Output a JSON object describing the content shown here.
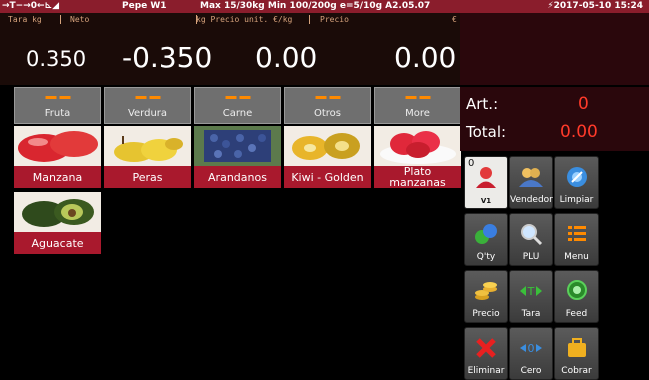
{
  "status": {
    "icons_text": "→T−→0←⊾◢",
    "user": "Pepe  W1",
    "limits": "Max 15/30kg Min 100/200g e=5/10g A2.05.07",
    "datetime": "2017-05-10 15:24",
    "bg_color": "#8a1d2c"
  },
  "display": {
    "labels": {
      "tara": "Tara   kg",
      "neto": "Neto",
      "precio_unit": "kg Precio unit.  €/kg",
      "precio": "Precio",
      "euro": "€"
    },
    "tara_value": "0.350",
    "neto_value": "-0.350",
    "unit_price_value": "0.00",
    "price_value": "0.00"
  },
  "categories": [
    {
      "label": "Fruta"
    },
    {
      "label": "Verdura"
    },
    {
      "label": "Carne"
    },
    {
      "label": "Otros"
    },
    {
      "label": "More"
    }
  ],
  "products": [
    {
      "name": "Manzana",
      "icon": "apples"
    },
    {
      "name": "Peras",
      "icon": "pears"
    },
    {
      "name": "Arandanos",
      "icon": "blueberries"
    },
    {
      "name": "Kiwi - Golden",
      "icon": "golden-kiwi"
    },
    {
      "name": "Plato manzanas",
      "icon": "apple-plate"
    },
    {
      "name": "Aguacate",
      "icon": "avocados"
    }
  ],
  "summary": {
    "art_label": "Art.:",
    "art_value": "0",
    "total_label": "Total:",
    "total_value": "0.00"
  },
  "function_keys": [
    {
      "label": "V1",
      "icon": "user-icon",
      "corner": "0"
    },
    {
      "label": "Vendedor",
      "icon": "users-icon"
    },
    {
      "label": "Limpiar",
      "icon": "clear-icon"
    },
    {
      "label": "Q'ty",
      "icon": "quantity-icon"
    },
    {
      "label": "PLU",
      "icon": "search-icon"
    },
    {
      "label": "Menu",
      "icon": "menu-icon"
    },
    {
      "label": "Precio",
      "icon": "coins-icon"
    },
    {
      "label": "Tara",
      "icon": "tare-icon"
    },
    {
      "label": "Feed",
      "icon": "feed-icon"
    },
    {
      "label": "Eliminar",
      "icon": "delete-icon"
    },
    {
      "label": "Cero",
      "icon": "zero-icon"
    },
    {
      "label": "Cobrar",
      "icon": "checkout-icon"
    }
  ],
  "colors": {
    "accent_red": "#a9192d",
    "value_red": "#ff3a2a",
    "category_dash": "#ff8a00"
  }
}
